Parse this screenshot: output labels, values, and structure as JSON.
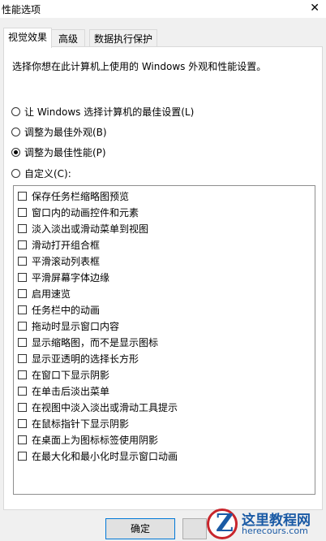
{
  "window": {
    "title": "性能选项",
    "close_glyph": "✕"
  },
  "tabs": [
    {
      "label": "视觉效果",
      "active": true
    },
    {
      "label": "高级",
      "active": false
    },
    {
      "label": "数据执行保护",
      "active": false
    }
  ],
  "description": "选择你想在此计算机上使用的 Windows 外观和性能设置。",
  "radios": [
    {
      "label": "让 Windows 选择计算机的最佳设置(L)",
      "checked": false
    },
    {
      "label": "调整为最佳外观(B)",
      "checked": false
    },
    {
      "label": "调整为最佳性能(P)",
      "checked": true
    },
    {
      "label": "自定义(C):",
      "checked": false
    }
  ],
  "options": [
    "保存任务栏缩略图预览",
    "窗口内的动画控件和元素",
    "淡入淡出或滑动菜单到视图",
    "滑动打开组合框",
    "平滑滚动列表框",
    "平滑屏幕字体边缘",
    "启用速览",
    "任务栏中的动画",
    "拖动时显示窗口内容",
    "显示缩略图，而不是显示图标",
    "显示亚透明的选择长方形",
    "在窗口下显示阴影",
    "在单击后淡出菜单",
    "在视图中淡入淡出或滑动工具提示",
    "在鼠标指针下显示阴影",
    "在桌面上为图标标签使用阴影",
    "在最大化和最小化时显示窗口动画"
  ],
  "buttons": {
    "ok": "确定"
  },
  "watermark": {
    "logo_letter": "Z",
    "title": "这里教程网",
    "url": "herecours.com"
  }
}
